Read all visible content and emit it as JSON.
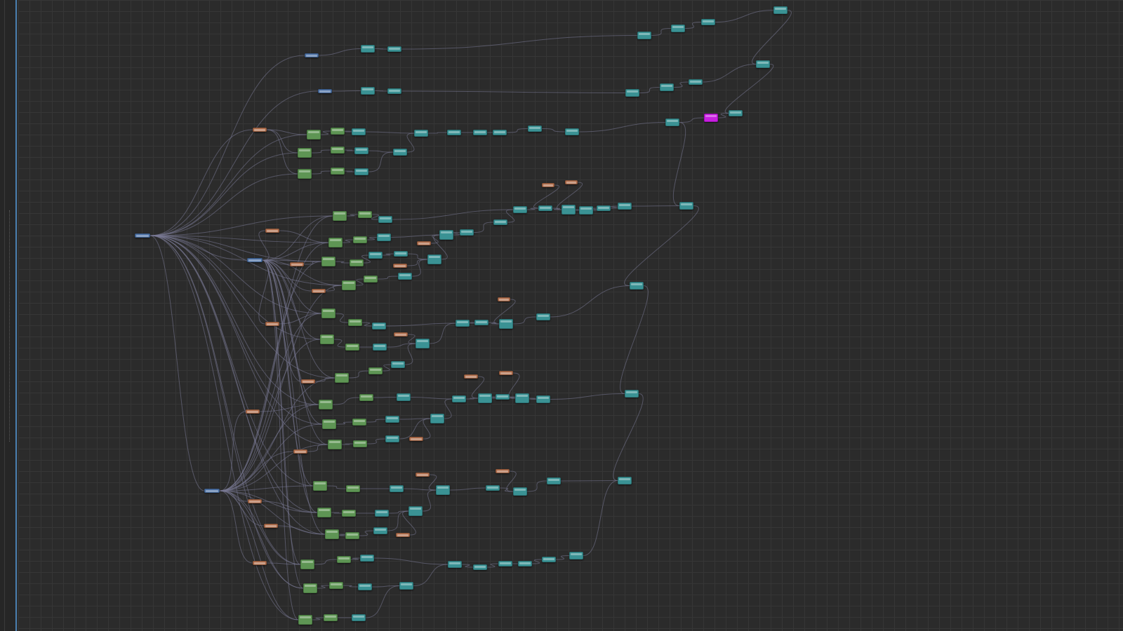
{
  "app": {
    "view": "node-graph-editor"
  },
  "colors": {
    "canvas_background": "#2b2b2b",
    "grid_line": "#363636",
    "wire": "#7a7a96",
    "teal_node": "#3a9294",
    "green_node": "#5e9554",
    "orange_node": "#b06e4c",
    "blue_node": "#4d72a6",
    "magenta_node": "#c81fe0",
    "left_accent": "#4a7fb0"
  },
  "node_types": {
    "teal": "teal-node",
    "green": "green-node",
    "orange": "orange-node",
    "blue": "blue-node",
    "magenta": "magenta-node"
  },
  "selection": {
    "highlighted_node_type": "magenta"
  }
}
